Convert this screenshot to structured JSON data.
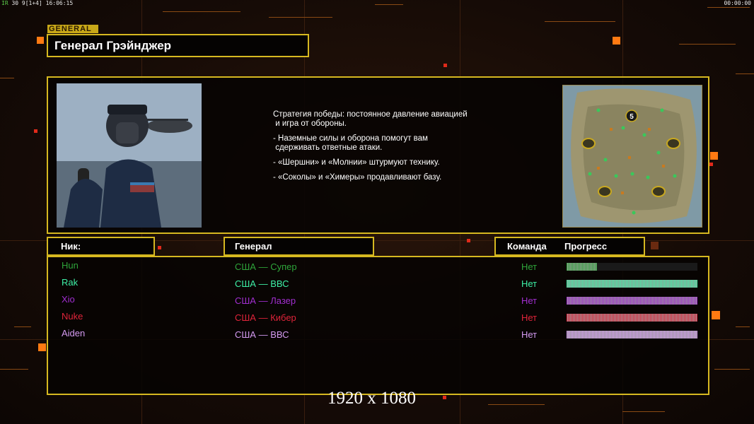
{
  "status": {
    "left_prefix": "IR",
    "left_text": "30 9[1+4] 16:06:15",
    "right_text": "00:00:00"
  },
  "section_tag": "GENERAL",
  "general_name": "Генерал Грэйнджер",
  "strategy": [
    "Стратегия победы: постоянное давление авиацией\n и игра от обороны.",
    "- Наземные силы и оборона помогут вам\n сдерживать ответные атаки.",
    "- «Шершни» и «Молнии» штурмуют технику.",
    "- «Соколы» и «Химеры» продавливают базу."
  ],
  "minimap": {
    "marker_label": "5"
  },
  "headers": {
    "nick": "Ник:",
    "general": "Генерал",
    "team": "Команда",
    "progress": "Прогресс"
  },
  "players": [
    {
      "nick": "Hun",
      "general": "США — Супер",
      "team": "Нет",
      "progress": 0.23,
      "color": "#2ea43a"
    },
    {
      "nick": "Rak",
      "general": "США — ВВС",
      "team": "Нет",
      "progress": 1.0,
      "color": "#3ef0a6"
    },
    {
      "nick": "Xio",
      "general": "США — Лазер",
      "team": "Нет",
      "progress": 1.0,
      "color": "#a22ed0"
    },
    {
      "nick": "Nuke",
      "general": "США — Кибер",
      "team": "Нет",
      "progress": 1.0,
      "color": "#e0243a"
    },
    {
      "nick": "Aiden",
      "general": "США — ВВС",
      "team": "Нет",
      "progress": 1.0,
      "color": "#d49af0"
    }
  ],
  "resolution_watermark": "1920 x 1080",
  "colors": {
    "frame": "#d6b820",
    "accent_orange": "#ff7a12"
  }
}
